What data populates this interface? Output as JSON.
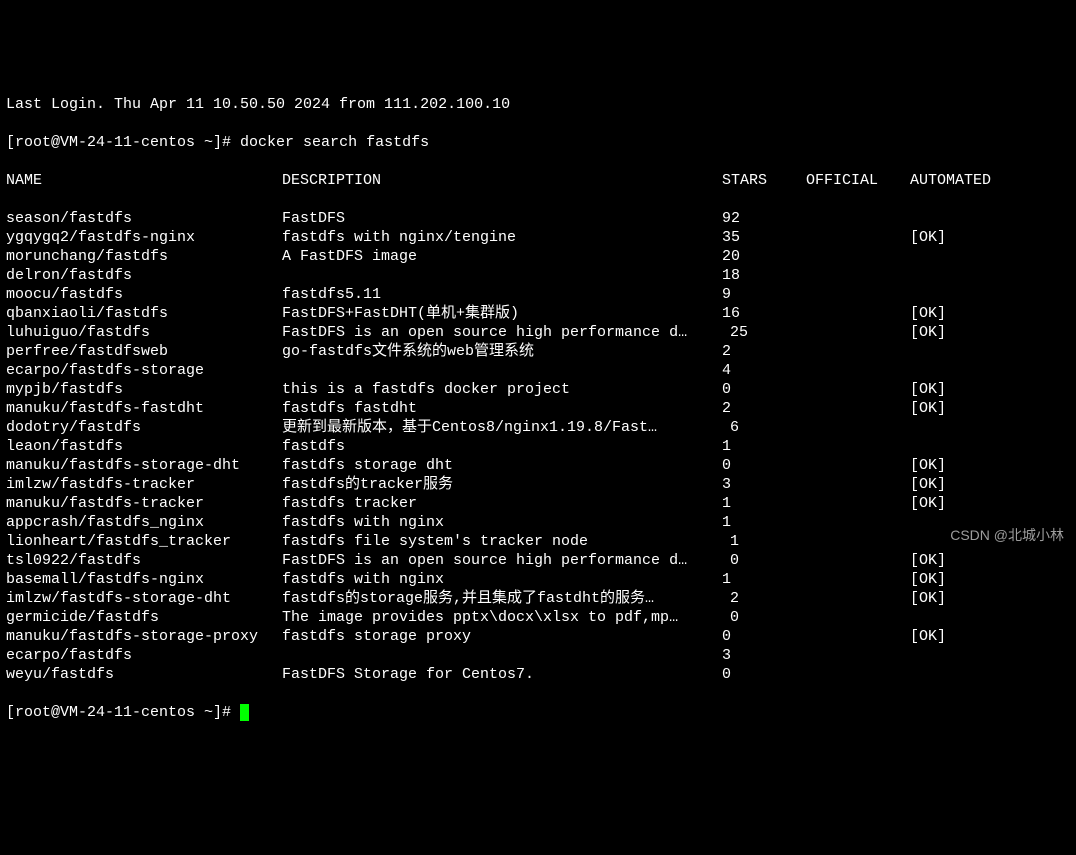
{
  "pre_line": "Last Login. Thu Apr 11 10.50.50 2024 from 111.202.100.10",
  "prompt1": "[root@VM-24-11-centos ~]# ",
  "command": "docker search fastdfs",
  "headers": {
    "name": "NAME",
    "description": "DESCRIPTION",
    "stars": "STARS",
    "official": "OFFICIAL",
    "automated": "AUTOMATED"
  },
  "rows": [
    {
      "name": "season/fastdfs",
      "description": "FastDFS",
      "stars": "92",
      "official": "",
      "automated": "",
      "indent": false
    },
    {
      "name": "ygqygq2/fastdfs-nginx",
      "description": "fastdfs with nginx/tengine",
      "stars": "35",
      "official": "",
      "automated": "[OK]",
      "indent": false
    },
    {
      "name": "morunchang/fastdfs",
      "description": "A FastDFS image",
      "stars": "20",
      "official": "",
      "automated": "",
      "indent": false
    },
    {
      "name": "delron/fastdfs",
      "description": "",
      "stars": "18",
      "official": "",
      "automated": "",
      "indent": false
    },
    {
      "name": "moocu/fastdfs",
      "description": "fastdfs5.11",
      "stars": "9",
      "official": "",
      "automated": "",
      "indent": false
    },
    {
      "name": "qbanxiaoli/fastdfs",
      "description": "FastDFS+FastDHT(单机+集群版)",
      "stars": "16",
      "official": "",
      "automated": "[OK]",
      "indent": false
    },
    {
      "name": "luhuiguo/fastdfs",
      "description": "FastDFS is an open source high performance d…",
      "stars": "25",
      "official": "",
      "automated": "[OK]",
      "indent": true
    },
    {
      "name": "perfree/fastdfsweb",
      "description": "go-fastdfs文件系统的web管理系统",
      "stars": "2",
      "official": "",
      "automated": "",
      "indent": false
    },
    {
      "name": "ecarpo/fastdfs-storage",
      "description": "",
      "stars": "4",
      "official": "",
      "automated": "",
      "indent": false
    },
    {
      "name": "mypjb/fastdfs",
      "description": "this is a fastdfs docker project",
      "stars": "0",
      "official": "",
      "automated": "[OK]",
      "indent": false
    },
    {
      "name": "manuku/fastdfs-fastdht",
      "description": "fastdfs fastdht",
      "stars": "2",
      "official": "",
      "automated": "[OK]",
      "indent": false
    },
    {
      "name": "dodotry/fastdfs",
      "description": "更新到最新版本，基于Centos8/nginx1.19.8/Fast…",
      "stars": "6",
      "official": "",
      "automated": "",
      "indent": true
    },
    {
      "name": "leaon/fastdfs",
      "description": "fastdfs",
      "stars": "1",
      "official": "",
      "automated": "",
      "indent": false
    },
    {
      "name": "manuku/fastdfs-storage-dht",
      "description": "fastdfs storage dht",
      "stars": "0",
      "official": "",
      "automated": "[OK]",
      "indent": false
    },
    {
      "name": "imlzw/fastdfs-tracker",
      "description": "fastdfs的tracker服务",
      "stars": "3",
      "official": "",
      "automated": "[OK]",
      "indent": false
    },
    {
      "name": "manuku/fastdfs-tracker",
      "description": "fastdfs tracker",
      "stars": "1",
      "official": "",
      "automated": "[OK]",
      "indent": false
    },
    {
      "name": "appcrash/fastdfs_nginx",
      "description": "fastdfs with nginx",
      "stars": "1",
      "official": "",
      "automated": "",
      "indent": false
    },
    {
      "name": "lionheart/fastdfs_tracker",
      "description": "fastdfs file system's tracker node",
      "stars": "1",
      "official": "",
      "automated": "",
      "indent": true
    },
    {
      "name": "tsl0922/fastdfs",
      "description": "FastDFS is an open source high performance d…",
      "stars": "0",
      "official": "",
      "automated": "[OK]",
      "indent": true
    },
    {
      "name": "basemall/fastdfs-nginx",
      "description": "fastdfs with nginx",
      "stars": "1",
      "official": "",
      "automated": "[OK]",
      "indent": false
    },
    {
      "name": "imlzw/fastdfs-storage-dht",
      "description": "fastdfs的storage服务,并且集成了fastdht的服务…",
      "stars": "2",
      "official": "",
      "automated": "[OK]",
      "indent": true
    },
    {
      "name": "germicide/fastdfs",
      "description": "The image provides  pptx\\docx\\xlsx to pdf,mp…",
      "stars": "0",
      "official": "",
      "automated": "",
      "indent": true
    },
    {
      "name": "manuku/fastdfs-storage-proxy",
      "description": "fastdfs storage proxy",
      "stars": "0",
      "official": "",
      "automated": "[OK]",
      "indent": false
    },
    {
      "name": "ecarpo/fastdfs",
      "description": "",
      "stars": "3",
      "official": "",
      "automated": "",
      "indent": false
    },
    {
      "name": "weyu/fastdfs",
      "description": "FastDFS Storage for Centos7.",
      "stars": "0",
      "official": "",
      "automated": "",
      "indent": false
    }
  ],
  "prompt2": "[root@VM-24-11-centos ~]# ",
  "watermark": "CSDN @北城小林"
}
